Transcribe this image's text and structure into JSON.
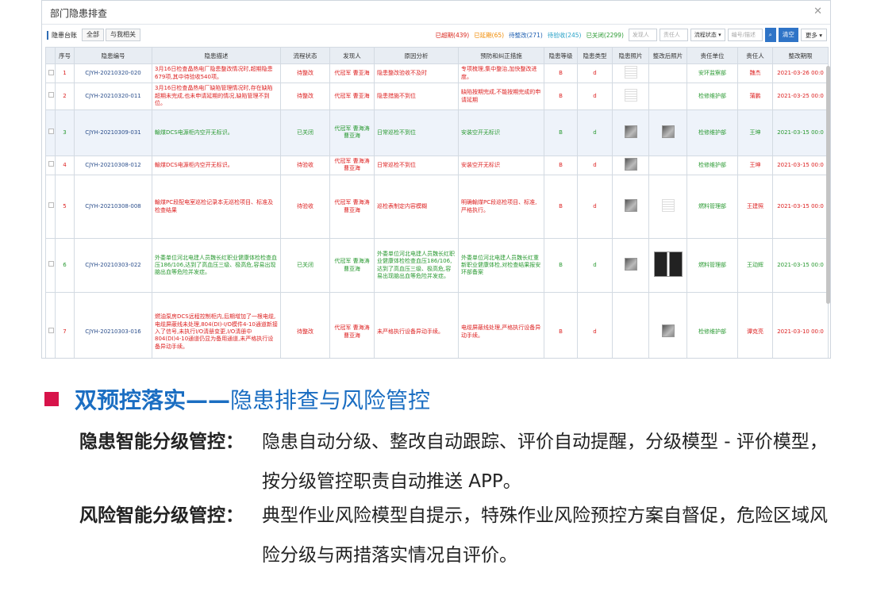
{
  "window": {
    "title": "部门隐患排查",
    "close_icon": "close-icon"
  },
  "toolbar": {
    "ledger_label": "隐患台账",
    "tab_all": "全部",
    "tab_mine": "与我相关",
    "stats": [
      {
        "label": "已超期(439)",
        "color": "#d9261c"
      },
      {
        "label": "已延期(65)",
        "color": "#f08a00"
      },
      {
        "label": "待整改(271)",
        "color": "#1f5fb0"
      },
      {
        "label": "待验收(245)",
        "color": "#27a1c7"
      },
      {
        "label": "已关闭(2299)",
        "color": "#2a9a32"
      }
    ],
    "finder_placeholder": "发现人",
    "owner_placeholder": "责任人",
    "status_select": "流程状态",
    "search_placeholder": "编号/描述",
    "clear_label": "清空",
    "more_label": "更多"
  },
  "table": {
    "headers": [
      "序号",
      "隐患编号",
      "隐患描述",
      "流程状态",
      "发现人",
      "原因分析",
      "预防和纠正措施",
      "隐患等级",
      "隐患类型",
      "隐患照片",
      "整改后照片",
      "责任单位",
      "责任人",
      "整改期限"
    ],
    "rows": [
      {
        "no": "1",
        "code": "CJYH-20210320-020",
        "desc": "3月16日检查晶热电厂隐患整改情况时,超期隐患679项,其中待验收540项。",
        "status": "待整改",
        "finder": "代冠军 曹亚海",
        "cause": "隐患整改验收不及时",
        "measure": "专项梳理,集中整治,加快整改进度。",
        "level": "B",
        "type": "d",
        "photo": "doc",
        "after": "",
        "unit": "安环监察部",
        "owner": "魏杰",
        "deadline": "2021-03-26 00:0",
        "color": "red"
      },
      {
        "no": "2",
        "code": "CJYH-20210320-011",
        "desc": "3月16日检查晶热电厂缺陷管理情况时,存在缺陷超期未完成,也未申请延期的情况,缺陷管理不到位。",
        "status": "待整改",
        "finder": "代冠军 曹亚海",
        "cause": "隐患措施不到位",
        "measure": "缺陷按期完成,不能按期完成的申请延期",
        "level": "B",
        "type": "d",
        "photo": "doc",
        "after": "",
        "unit": "检修维护部",
        "owner": "蒲鹏",
        "deadline": "2021-03-25 00:0",
        "color": "red"
      },
      {
        "no": "3",
        "code": "CJYH-20210309-031",
        "desc": "輸煤DCS电源柜内空开无标识。",
        "status": "已关闭",
        "finder": "代冠军 曹海涛 曹亚海",
        "cause": "日常巡检不到位",
        "measure": "安装空开无标识",
        "level": "B",
        "type": "d",
        "photo": "img",
        "after": "img",
        "unit": "检修维护部",
        "owner": "王坤",
        "deadline": "2021-03-15 00:0",
        "color": "green",
        "hl": true
      },
      {
        "no": "4",
        "code": "CJYH-20210308-012",
        "desc": "輸煤DCS电源柜内空开无标识。",
        "status": "待验收",
        "finder": "代冠军 曹海涛 曹亚海",
        "cause": "日常巡检不到位",
        "measure": "安装空开无标识",
        "level": "B",
        "type": "d",
        "photo": "img",
        "after": "",
        "unit": "检修维护部",
        "owner": "王坤",
        "deadline": "2021-03-15 00:0",
        "color": "red"
      },
      {
        "no": "5",
        "code": "CJYH-20210308-008",
        "desc": "輸煤PC段配电室巡检记录本无巡检项目、标准及检查结果",
        "status": "待验收",
        "finder": "代冠军 曹海涛 曹亚海",
        "cause": "巡检表制定内容模糊",
        "measure": "明确輸煤PC段巡检项目、标准,严格执行。",
        "level": "B",
        "type": "d",
        "photo": "img",
        "after": "doc",
        "unit": "燃料管理部",
        "owner": "王建照",
        "deadline": "2021-03-15 00:0",
        "color": "red"
      },
      {
        "no": "6",
        "code": "CJYH-20210303-022",
        "desc": "外委单位河北电建人员魏长红职业健康体检检查血压186/106,达到了高血压三级、极高危,容易出现脑出血等危险并发症。",
        "status": "已关闭",
        "finder": "代冠军 曹海涛 曹亚海",
        "cause": "外委单位河北电建人员魏长红职业健康体检检查血压186/106,达到了高血压三级、极高危,容易出现脑出血等危险并发症。",
        "measure": "外委单位河北电建人员魏长红重新职业健康体检,对检查结果报安环部备案",
        "level": "B",
        "type": "d",
        "photo": "img",
        "after": "pair",
        "unit": "燃料管理部",
        "owner": "王动辉",
        "deadline": "2021-03-15 00:0",
        "color": "green"
      },
      {
        "no": "7",
        "code": "CJYH-20210303-016",
        "desc": "燃油泵房DCS远程控制柜内,后期增加了一根电缆,电缆屏蔽线未处理,804(DI)-I/O模件4-10通道新接入了信号,未执行I/O清册变更,I/O清册中804(DI)4-10通道仍显为备用通道,未严格执行设备异动手续。",
        "status": "待整改",
        "finder": "代冠军 曹海涛 曹亚海",
        "cause": "未严格执行设备异动手续。",
        "measure": "电缆屏蔽线处理,严格执行设备异动手续。",
        "level": "B",
        "type": "d",
        "photo": "",
        "after": "img",
        "unit": "检修维护部",
        "owner": "谭克亮",
        "deadline": "2021-03-10 00:0",
        "color": "red"
      }
    ]
  },
  "section": {
    "title_bold": "双预控落实——",
    "title_regular": "隐患排查与风险管控",
    "items": [
      {
        "label": "隐患智能分级管控：",
        "text": "隐患自动分级、整改自动跟踪、评价自动提醒，分级模型 - 评价模型，按分级管控职责自动推送 APP。"
      },
      {
        "label": "风险智能分级管控：",
        "text": "典型作业风险模型自提示，特殊作业风险预控方案自督促，危险区域风险分级与两措落实情况自评价。"
      }
    ]
  }
}
